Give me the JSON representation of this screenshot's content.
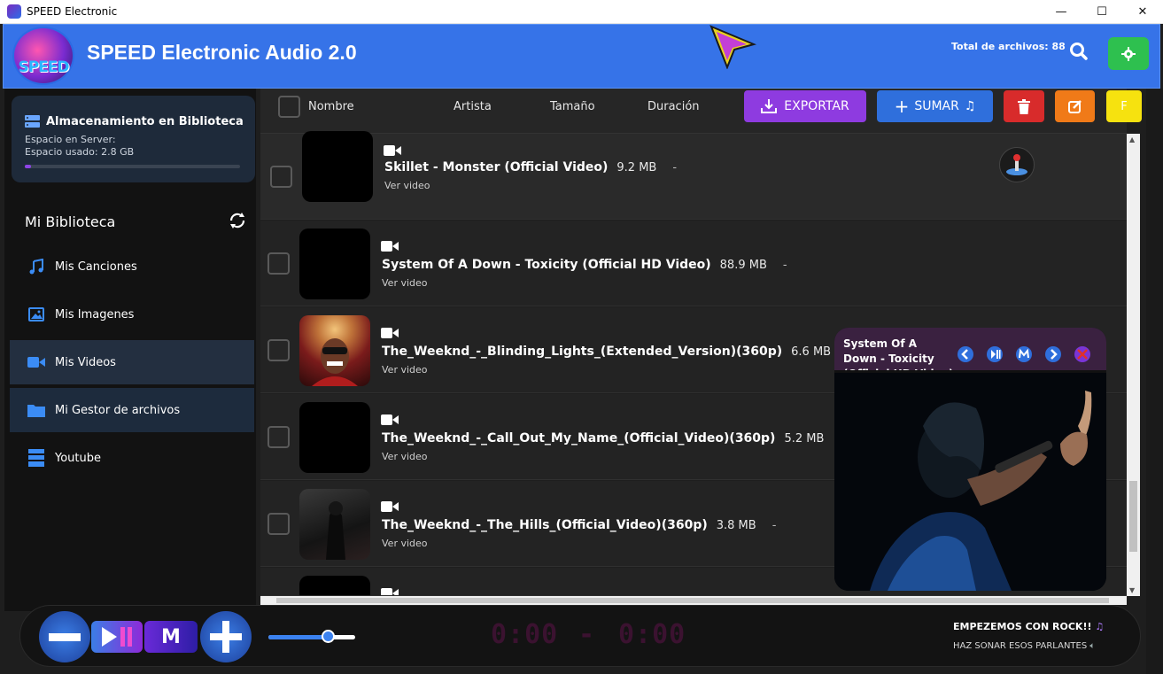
{
  "window": {
    "title": "SPEED Electronic",
    "controls": [
      "—",
      "☐",
      "✕"
    ]
  },
  "header": {
    "logo_text": "SPEED",
    "app_title": "SPEED Electronic Audio 2.0",
    "total_label": "Total de archivos: 88"
  },
  "sidebar": {
    "storage": {
      "title": "Almacenamiento en Biblioteca",
      "server_line": "Espacio en Server:",
      "used_line": "Espacio usado: 2.8 GB",
      "used_fraction": 0.03
    },
    "library_title": "Mi Biblioteca",
    "items": [
      {
        "label": "Mis Canciones",
        "icon": "music-note-icon"
      },
      {
        "label": "Mis Imagenes",
        "icon": "image-icon"
      },
      {
        "label": "Mis Videos",
        "icon": "video-icon"
      },
      {
        "label": "Mi Gestor de archivos",
        "icon": "folder-icon"
      },
      {
        "label": "Youtube",
        "icon": "server-icon"
      }
    ]
  },
  "list": {
    "columns": [
      "Nombre",
      "Artista",
      "Tamaño",
      "Duración"
    ],
    "buttons": {
      "export": "EXPORTAR",
      "add": "SUMAR",
      "f": "F"
    },
    "rows": [
      {
        "title": "Skillet - Monster (Official Video)",
        "size": "9.2 MB",
        "duration": "-",
        "sub": "Ver video"
      },
      {
        "title": "System Of A Down - Toxicity (Official HD Video)",
        "size": "88.9 MB",
        "duration": "-",
        "sub": "Ver video"
      },
      {
        "title": "The_Weeknd_-_Blinding_Lights_(Extended_Version)(360p)",
        "size": "6.6 MB",
        "duration": "-",
        "sub": "Ver video"
      },
      {
        "title": "The_Weeknd_-_Call_Out_My_Name_(Official_Video)(360p)",
        "size": "5.2 MB",
        "duration": "-",
        "sub": "Ver video"
      },
      {
        "title": "The_Weeknd_-_The_Hills_(Official_Video)(360p)",
        "size": "3.8 MB",
        "duration": "-",
        "sub": "Ver video"
      },
      {
        "title": "",
        "size": "",
        "duration": "",
        "sub": ""
      }
    ]
  },
  "player": {
    "title": "System Of A Down - Toxicity (Official HD Video)"
  },
  "bottom": {
    "time_current": "0:00",
    "time_separator": "-",
    "time_total": "0:00",
    "message_1": "EMPEZEMOS CON ROCK!!",
    "message_2": "HAZ SONAR ESOS PARLANTES",
    "volume_fraction": 0.68,
    "m_label": "M"
  }
}
